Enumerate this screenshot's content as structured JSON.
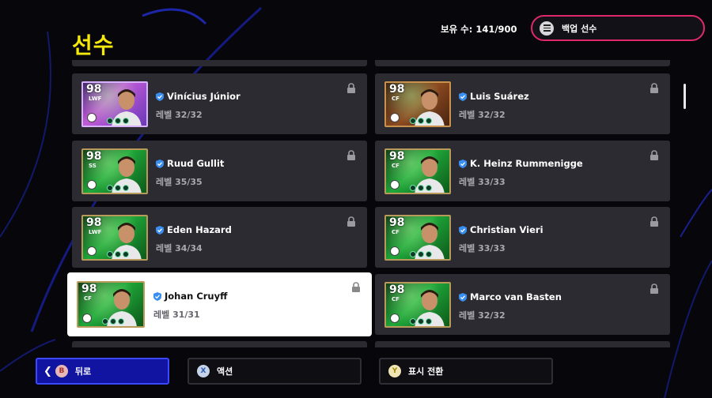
{
  "header": {
    "title": "선수",
    "owned_count": "보유 수: 141/900",
    "backup_label": "백업 선수"
  },
  "colors": {
    "title": "#f5e80c",
    "backup_border": "#e0286c",
    "primary_button": "#1014a0",
    "selected_card": "#ffffff"
  },
  "players": [
    {
      "name": "Vinícius Júnior",
      "level": "레벨 32/32",
      "rating": "98",
      "position": "LWF",
      "style": "legend",
      "selected": false
    },
    {
      "name": "Luis Suárez",
      "level": "레벨 32/32",
      "rating": "98",
      "position": "CF",
      "style": "brown",
      "selected": false
    },
    {
      "name": "Ruud Gullit",
      "level": "레벨 35/35",
      "rating": "98",
      "position": "SS",
      "style": "green",
      "selected": false
    },
    {
      "name": "K. Heinz Rummenigge",
      "level": "레벨 33/33",
      "rating": "98",
      "position": "CF",
      "style": "green",
      "selected": false
    },
    {
      "name": "Eden Hazard",
      "level": "레벨 34/34",
      "rating": "98",
      "position": "LWF",
      "style": "green",
      "selected": false
    },
    {
      "name": "Christian Vieri",
      "level": "레벨 33/33",
      "rating": "98",
      "position": "CF",
      "style": "green",
      "selected": false
    },
    {
      "name": "Johan Cruyff",
      "level": "레벨 31/31",
      "rating": "98",
      "position": "CF",
      "style": "green",
      "selected": true
    },
    {
      "name": "Marco van Basten",
      "level": "레벨 32/32",
      "rating": "98",
      "position": "CF",
      "style": "green",
      "selected": false
    }
  ],
  "footer": {
    "back_key": "B",
    "back_label": "뒤로",
    "action_key": "X",
    "action_label": "액션",
    "toggle_key": "Y",
    "toggle_label": "표시 전환"
  }
}
